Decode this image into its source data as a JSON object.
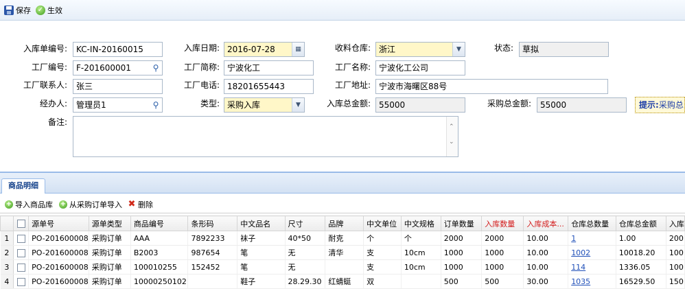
{
  "toolbar": {
    "save_label": "保存",
    "effect_label": "生效"
  },
  "form": {
    "receipt_no": {
      "label": "入库单编号:",
      "value": "KC-IN-20160015"
    },
    "receipt_date": {
      "label": "入库日期:",
      "value": "2016-07-28"
    },
    "warehouse": {
      "label": "收料仓库:",
      "value": "浙江"
    },
    "status": {
      "label": "状态:",
      "value": "草拟"
    },
    "factory_no": {
      "label": "工厂编号:",
      "value": "F-201600001"
    },
    "factory_short": {
      "label": "工厂简称:",
      "value": "宁波化工"
    },
    "factory_name": {
      "label": "工厂名称:",
      "value": "宁波化工公司"
    },
    "factory_contact": {
      "label": "工厂联系人:",
      "value": "张三"
    },
    "factory_phone": {
      "label": "工厂电话:",
      "value": "18201655443"
    },
    "factory_address": {
      "label": "工厂地址:",
      "value": "宁波市海曙区88号"
    },
    "handler": {
      "label": "经办人:",
      "value": "管理员1"
    },
    "type": {
      "label": "类型:",
      "value": "采购入库"
    },
    "total_in": {
      "label": "入库总金额:",
      "value": "55000"
    },
    "total_purchase": {
      "label": "采购总金额:",
      "value": "55000"
    },
    "remark": {
      "label": "备注:",
      "value": ""
    },
    "hint": {
      "bold": "提示:",
      "text": "采购总"
    }
  },
  "panel": {
    "tab_label": "商品明细",
    "buttons": {
      "import_product": "导入商品库",
      "import_order": "从采购订单导入",
      "delete": "删除"
    },
    "columns": [
      "源单号",
      "源单类型",
      "商品编号",
      "条形码",
      "中文品名",
      "尺寸",
      "品牌",
      "中文单位",
      "中文规格",
      "订单数量",
      "入库数量",
      "入库成本...",
      "仓库总数量",
      "仓库总金额",
      "入库"
    ],
    "rows": [
      {
        "n": "1",
        "cells": [
          "PO-201600008",
          "采购订单",
          "AAA",
          "7892233",
          "袜子",
          "40*50",
          "耐克",
          "个",
          "个",
          "2000",
          "2000",
          "10.00",
          "1",
          "1.00",
          "200"
        ]
      },
      {
        "n": "2",
        "cells": [
          "PO-201600008",
          "采购订单",
          "B2003",
          "987654",
          "笔",
          "无",
          "清华",
          "支",
          "10cm",
          "1000",
          "1000",
          "10.00",
          "1002",
          "10018.20",
          "100"
        ]
      },
      {
        "n": "3",
        "cells": [
          "PO-201600008",
          "采购订单",
          "100010255",
          "152452",
          "笔",
          "无",
          "",
          "支",
          "10cm",
          "1000",
          "1000",
          "10.00",
          "114",
          "1336.05",
          "100"
        ]
      },
      {
        "n": "4",
        "cells": [
          "PO-201600008",
          "采购订单",
          "10000250102",
          "",
          "鞋子",
          "28.29.30",
          "红蜻蜓",
          "双",
          "",
          "500",
          "500",
          "30.00",
          "1035",
          "16529.50",
          "150"
        ]
      }
    ]
  }
}
